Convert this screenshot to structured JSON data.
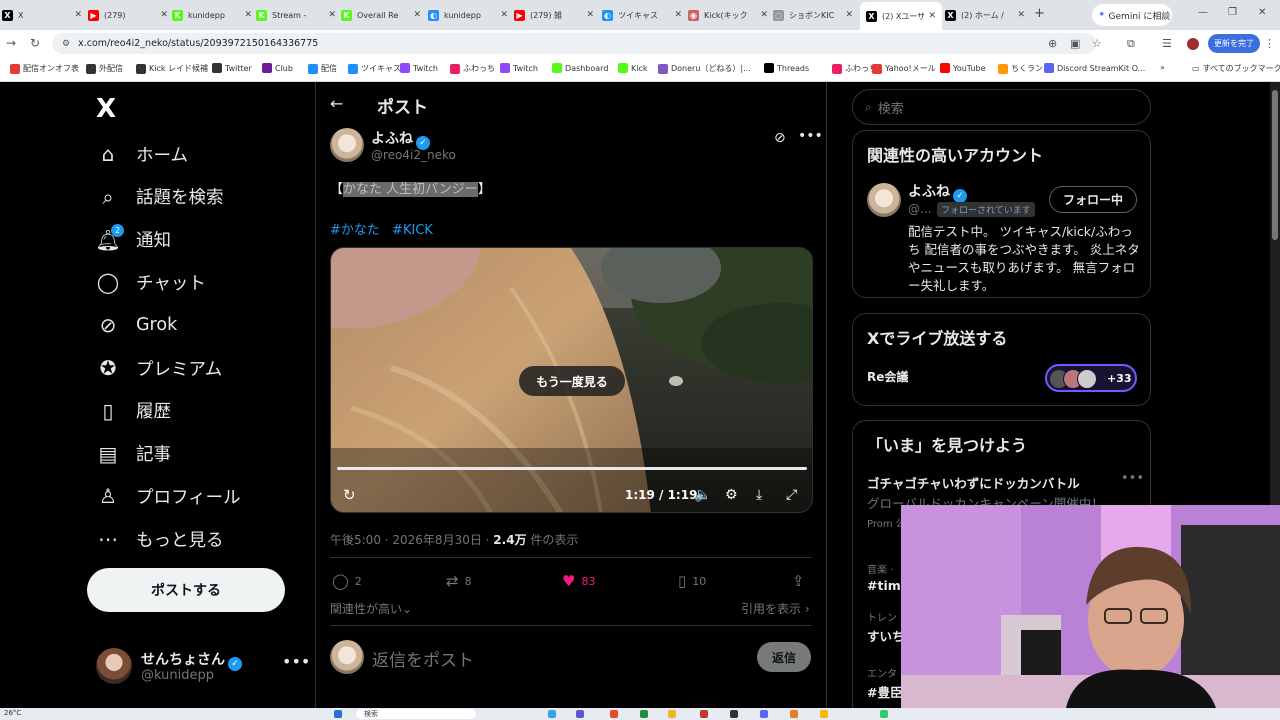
{
  "browser": {
    "tabs": [
      {
        "label": "X",
        "fav": "X",
        "color": "#000000"
      },
      {
        "label": "(279)",
        "fav": "▶",
        "color": "#ff0000"
      },
      {
        "label": "kunidepp",
        "fav": "K",
        "color": "#53fc18"
      },
      {
        "label": "Stream -",
        "fav": "K",
        "color": "#53fc18"
      },
      {
        "label": "Overall Re",
        "fav": "K",
        "color": "#53fc18"
      },
      {
        "label": "kunidepp",
        "fav": "◐",
        "color": "#1e90ff"
      },
      {
        "label": "(279) 雑",
        "fav": "▶",
        "color": "#ff0000"
      },
      {
        "label": "ツイキャス",
        "fav": "◐",
        "color": "#1e90ff"
      },
      {
        "label": "Kick(キック",
        "fav": "◉",
        "color": "#cc6666"
      },
      {
        "label": "ショボンKIC",
        "fav": "◌",
        "color": "#9a9a9a"
      },
      {
        "label": "(2) Xユーザ",
        "fav": "X",
        "color": "#000000"
      },
      {
        "label": "(2) ホーム /",
        "fav": "X",
        "color": "#000000"
      }
    ],
    "gemini_label": "Gemini に相談",
    "url": "x.com/reo4i2_neko/status/2093972150164336775",
    "update_label": "更新を完了",
    "bookmarks": [
      "配信オンオフ表",
      "外配信",
      "Kick レイド候補",
      "Twitter",
      "Club",
      "配信",
      "ツイキャス",
      "Twitch",
      "ふわっち",
      "Twitch",
      "Dashboard",
      "Kick",
      "Doneru（どねる）|...",
      "Threads",
      "ふわっち",
      "Yahoo!メール",
      "YouTube",
      "ちくラン",
      "Discord StreamKit O..."
    ],
    "all_bookmarks": "すべてのブックマーク"
  },
  "nav": {
    "logo": "X",
    "items": [
      {
        "label": "ホーム",
        "icon": "home-icon"
      },
      {
        "label": "話題を検索",
        "icon": "search-icon"
      },
      {
        "label": "通知",
        "icon": "bell-icon",
        "badge": "2"
      },
      {
        "label": "チャット",
        "icon": "chat-icon"
      },
      {
        "label": "Grok",
        "icon": "grok-icon"
      },
      {
        "label": "プレミアム",
        "icon": "premium-icon"
      },
      {
        "label": "履歴",
        "icon": "bookmark-icon"
      },
      {
        "label": "記事",
        "icon": "article-icon"
      },
      {
        "label": "プロフィール",
        "icon": "profile-icon"
      },
      {
        "label": "もっと見る",
        "icon": "more-icon"
      }
    ],
    "post_button": "ポストする",
    "me": {
      "name": "せんちょさん",
      "handle": "@kunidepp"
    }
  },
  "post": {
    "header_title": "ポスト",
    "author_name": "よふね",
    "author_handle": "@reo4i2_neko",
    "text_open": "【",
    "text_highlight": "かなた 人生初バンジー",
    "text_close": "】",
    "hashtags": [
      "#かなた",
      "#KICK"
    ],
    "video": {
      "replay_label": "もう一度見る",
      "time": "1:19 / 1:19",
      "progress": 1.0
    },
    "time_line": "午後5:00 · 2026年8月30日 · ",
    "views_count": "2.4万",
    "views_label": " 件の表示",
    "replies": "2",
    "reposts": "8",
    "likes": "83",
    "bookmarks": "10",
    "relevance_label": "関連性が高い⌄",
    "quotes_label": "引用を表示 ›",
    "reply_placeholder": "返信をポスト",
    "reply_button": "返信"
  },
  "sidebar": {
    "search_placeholder": "検索",
    "related": {
      "title": "関連性の高いアカウント",
      "name": "よふね",
      "handle": "@...",
      "follows_you": "フォローされています",
      "follow_button": "フォロー中",
      "bio": "配信テスト中。 ツイキャス/kick/ふわっち 配信者の事をつぶやきます。 炎上ネタやニュースも取りあげます。 無言フォロー失礼します。"
    },
    "live": {
      "title": "Xでライブ放送する",
      "space": "Re会議",
      "count": "+33"
    },
    "trends": {
      "title": "「いま」を見つけよう",
      "topic": "ゴチャゴチャいわずにドッカンバトル",
      "sub": "グローバルドッカンキャンペーン開催中！",
      "promo": "Prom 公式",
      "items": [
        {
          "label": "音楽 ·",
          "value": "#time"
        },
        {
          "label": "トレン",
          "value": "すいち"
        },
        {
          "label": "エンタ",
          "value": "#豊臣"
        }
      ]
    }
  },
  "taskbar": {
    "weather": "26°C",
    "search": "検索"
  },
  "colors": {
    "accent": "#1d9bf0",
    "like": "#f91880",
    "background": "#000000"
  }
}
